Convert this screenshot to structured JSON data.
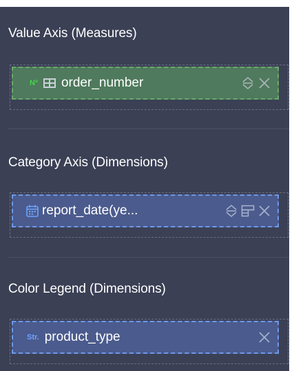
{
  "panel": {
    "sections": [
      {
        "title": "Value Axis (Measures)",
        "field": {
          "type_badge": "Nº",
          "name": "order_number"
        }
      },
      {
        "title": "Category Axis (Dimensions)",
        "field": {
          "name": "report_date(ye..."
        }
      },
      {
        "title": "Color Legend (Dimensions)",
        "field": {
          "type_badge": "Str.",
          "name": "product_type"
        }
      }
    ]
  },
  "colors": {
    "panel_bg": "#3b4055",
    "measure_chip_bg": "#4f7a5d",
    "measure_chip_border": "#6aaa6a",
    "dimension_chip_bg": "#4b5b8d",
    "dimension_chip_border": "#6e99ea",
    "measure_badge": "#44d44a",
    "dimension_badge": "#6ea3ff"
  },
  "icons": {
    "measure_field": [
      "number-type-icon",
      "table-icon"
    ],
    "date_field": "calendar-icon",
    "string_field": "string-type-icon",
    "sort": "sort-icon",
    "format": "format-icon",
    "remove": "close-icon"
  }
}
